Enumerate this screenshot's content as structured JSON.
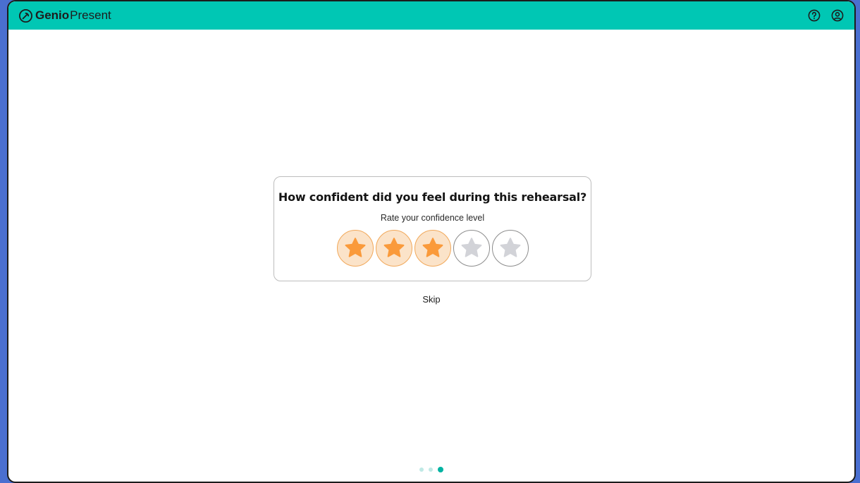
{
  "app": {
    "name_bold": "Genio",
    "name_light": "Present",
    "accent": "#00c7b4"
  },
  "header": {
    "icons": [
      "help-icon",
      "account-icon"
    ]
  },
  "feedback": {
    "question": "How confident did you feel during this rehearsal?",
    "subtitle": "Rate your confidence level",
    "rating": 3,
    "max_rating": 5,
    "star_color_active": "#fa9a3b",
    "star_color_inactive": "#d2d3d8"
  },
  "skip_label": "Skip",
  "pagination": {
    "total": 3,
    "current": 3
  }
}
